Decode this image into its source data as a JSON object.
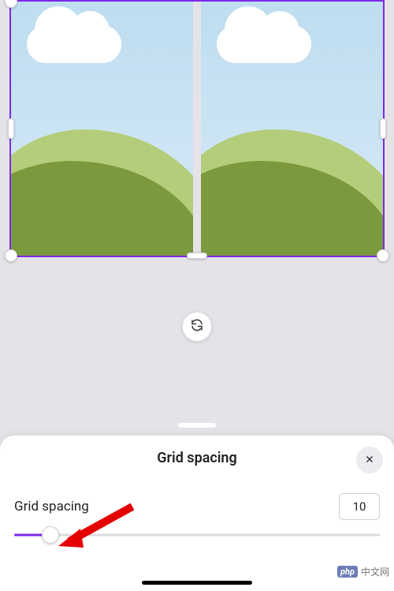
{
  "sheet": {
    "title": "Grid spacing",
    "control_label": "Grid spacing",
    "value": "10"
  },
  "slider": {
    "percent": 10
  },
  "icons": {
    "swap": "refresh-icon",
    "close": "close-icon"
  },
  "watermark": {
    "badge": "php",
    "text": "中文网"
  }
}
